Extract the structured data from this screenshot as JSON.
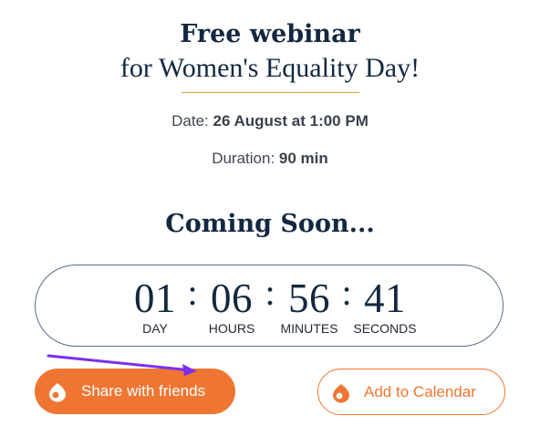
{
  "header": {
    "title": "Free webinar",
    "subtitle": "for Women's Equality Day!"
  },
  "details": {
    "date_label": "Date:",
    "date_value": "26 August at 1:00 PM",
    "duration_label": "Duration:",
    "duration_value": "90 min"
  },
  "countdown": {
    "heading": "Coming Soon...",
    "units": [
      {
        "value": "01",
        "label": "DAY"
      },
      {
        "value": "06",
        "label": "HOURS"
      },
      {
        "value": "56",
        "label": "MINUTES"
      },
      {
        "value": "41",
        "label": "SECONDS"
      }
    ],
    "separator": ":"
  },
  "actions": {
    "share_label": "Share with friends",
    "calendar_label": "Add to Calendar"
  },
  "colors": {
    "accent": "#ef7632",
    "heading": "#132840",
    "annotation_arrow": "#7b2ff2"
  },
  "icons": {
    "share": "share-icon",
    "calendar": "calendar-icon"
  }
}
